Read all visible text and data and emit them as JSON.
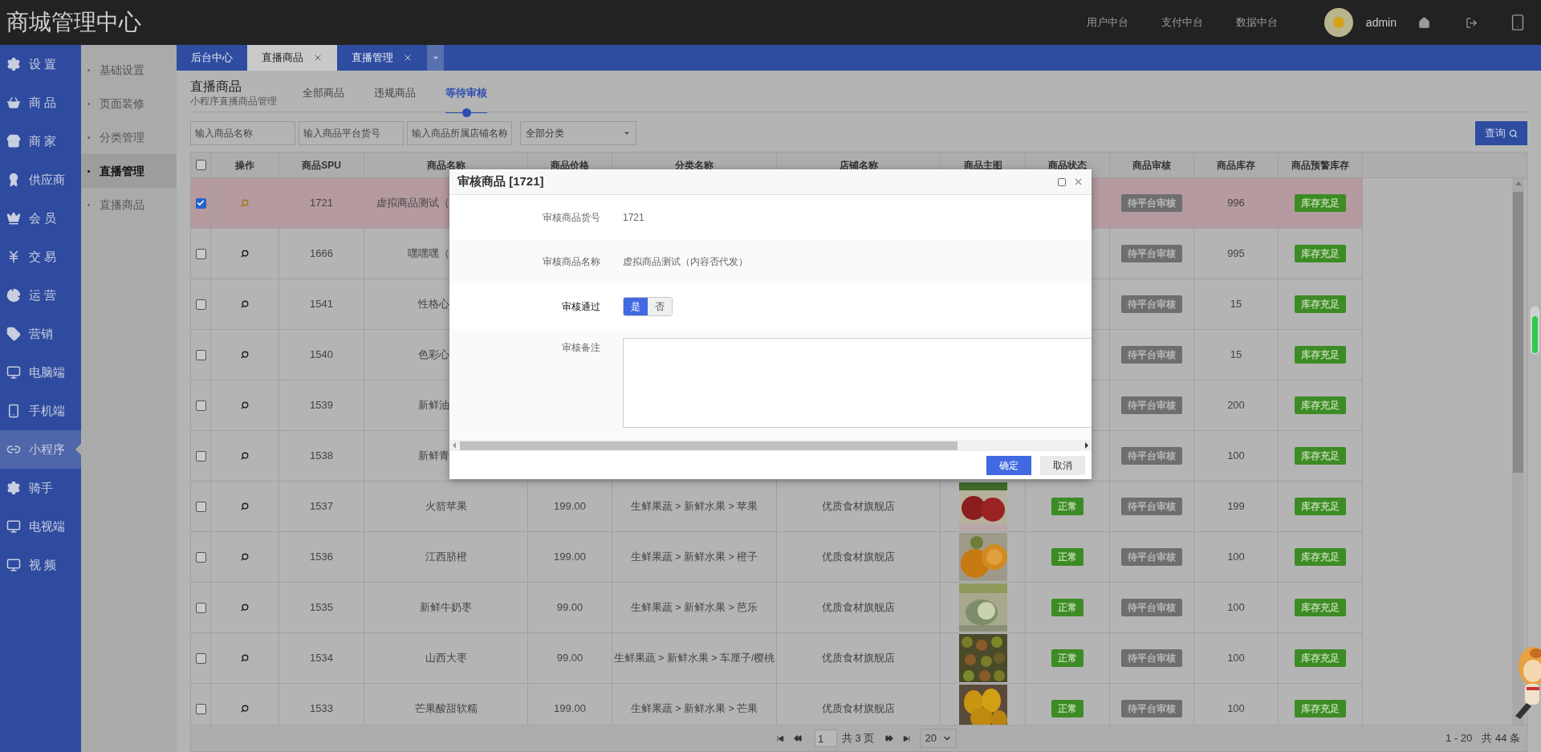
{
  "header": {
    "title": "商城管理中心",
    "links": [
      "用户中台",
      "支付中台",
      "数据中台"
    ],
    "user": "admin"
  },
  "nav": [
    {
      "label": "设 置",
      "selected": false
    },
    {
      "label": "商 品",
      "selected": false
    },
    {
      "label": "商 家",
      "selected": false
    },
    {
      "label": "供应商",
      "selected": false
    },
    {
      "label": "会 员",
      "selected": false
    },
    {
      "label": "交 易",
      "selected": false
    },
    {
      "label": "运 营",
      "selected": false
    },
    {
      "label": "营销",
      "selected": false
    },
    {
      "label": "电脑端",
      "selected": false
    },
    {
      "label": "手机端",
      "selected": false
    },
    {
      "label": "小程序",
      "selected": true
    },
    {
      "label": "骑手",
      "selected": false
    },
    {
      "label": "电视端",
      "selected": false
    },
    {
      "label": "视 频",
      "selected": false
    }
  ],
  "subnav": [
    {
      "label": "基础设置",
      "selected": false
    },
    {
      "label": "页面装修",
      "selected": false
    },
    {
      "label": "分类管理",
      "selected": false
    },
    {
      "label": "直播管理",
      "selected": true
    },
    {
      "label": "直播商品",
      "selected": false
    }
  ],
  "tabs": [
    {
      "label": "后台中心",
      "selected": false,
      "closable": false
    },
    {
      "label": "直播商品",
      "selected": true,
      "closable": true
    },
    {
      "label": "直播管理",
      "selected": false,
      "closable": true
    }
  ],
  "page": {
    "title": "直播商品",
    "subtitle": "小程序直播商品管理",
    "filters": [
      {
        "label": "全部商品",
        "selected": false
      },
      {
        "label": "违规商品",
        "selected": false
      },
      {
        "label": "等待审核",
        "selected": true
      }
    ]
  },
  "search": {
    "fields": [
      {
        "placeholder": "输入商品名称"
      },
      {
        "placeholder": "输入商品平台货号"
      },
      {
        "placeholder": "输入商品所属店铺名称"
      }
    ],
    "category": "全部分类",
    "button": "查询"
  },
  "table": {
    "header_checked": false,
    "columns": [
      "操作",
      "商品SPU",
      "商品名称",
      "商品价格",
      "分类名称",
      "店铺名称",
      "商品主图",
      "商品状态",
      "商品审核",
      "商品库存",
      "商品预警库存"
    ],
    "rows": [
      {
        "checked": true,
        "selected": true,
        "spu": "1721",
        "name": "虚拟商品测试（",
        "review": "待平台审核",
        "stock": "996",
        "alert": "库存充足"
      },
      {
        "checked": false,
        "selected": false,
        "spu": "1666",
        "name": "嘿嘿嘿（",
        "review": "待平台审核",
        "stock": "995",
        "alert": "库存充足"
      },
      {
        "checked": false,
        "selected": false,
        "spu": "1541",
        "name": "性格心",
        "review": "待平台审核",
        "stock": "15",
        "alert": "库存充足"
      },
      {
        "checked": false,
        "selected": false,
        "spu": "1540",
        "name": "色彩心",
        "review": "待平台审核",
        "stock": "15",
        "alert": "库存充足"
      },
      {
        "checked": false,
        "selected": false,
        "spu": "1539",
        "name": "新鲜油",
        "review": "待平台审核",
        "stock": "200",
        "alert": "库存充足"
      },
      {
        "checked": false,
        "selected": false,
        "spu": "1538",
        "name": "新鲜青",
        "review": "待平台审核",
        "stock": "100",
        "alert": "库存充足"
      },
      {
        "checked": false,
        "selected": false,
        "spu": "1537",
        "name": "火箭苹果",
        "price": "199.00",
        "category": "生鲜果蔬 > 新鲜水果 > 苹果",
        "shop": "优质食材旗舰店",
        "status": "正常",
        "review": "待平台审核",
        "stock": "199",
        "alert": "库存充足"
      },
      {
        "checked": false,
        "selected": false,
        "spu": "1536",
        "name": "江西脐橙",
        "price": "199.00",
        "category": "生鲜果蔬 > 新鲜水果 > 橙子",
        "shop": "优质食材旗舰店",
        "status": "正常",
        "review": "待平台审核",
        "stock": "100",
        "alert": "库存充足"
      },
      {
        "checked": false,
        "selected": false,
        "spu": "1535",
        "name": "新鲜牛奶枣",
        "price": "99.00",
        "category": "生鲜果蔬 > 新鲜水果 > 芭乐",
        "shop": "优质食材旗舰店",
        "status": "正常",
        "review": "待平台审核",
        "stock": "100",
        "alert": "库存充足"
      },
      {
        "checked": false,
        "selected": false,
        "spu": "1534",
        "name": "山西大枣",
        "price": "99.00",
        "category": "生鲜果蔬 > 新鲜水果 > 车厘子/樱桃",
        "shop": "优质食材旗舰店",
        "status": "正常",
        "review": "待平台审核",
        "stock": "100",
        "alert": "库存充足"
      },
      {
        "checked": false,
        "selected": false,
        "spu": "1533",
        "name": "芒果酸甜软糯",
        "price": "199.00",
        "category": "生鲜果蔬 > 新鲜水果 > 芒果",
        "shop": "优质食材旗舰店",
        "status": "正常",
        "review": "待平台审核",
        "stock": "100",
        "alert": "库存充足"
      }
    ]
  },
  "pagination": {
    "page": "1",
    "total_pages": "共 3 页",
    "page_size": "20",
    "range": "1 - 20",
    "total": "共 44 条"
  },
  "modal": {
    "title": "审核商品 [1721]",
    "fields": [
      {
        "kind": "text",
        "label": "审核商品货号",
        "value": "1721"
      },
      {
        "kind": "text",
        "label": "审核商品名称",
        "value": "虚拟商品测试（内容否代发）"
      },
      {
        "kind": "toggle",
        "label": "审核通过",
        "options": [
          {
            "label": "是",
            "selected": true
          },
          {
            "label": "否",
            "selected": false
          }
        ]
      },
      {
        "kind": "textarea",
        "label": "审核备注"
      }
    ],
    "buttons": [
      {
        "label": "确定",
        "kind": "primary"
      },
      {
        "label": "取消",
        "kind": "default"
      }
    ]
  }
}
